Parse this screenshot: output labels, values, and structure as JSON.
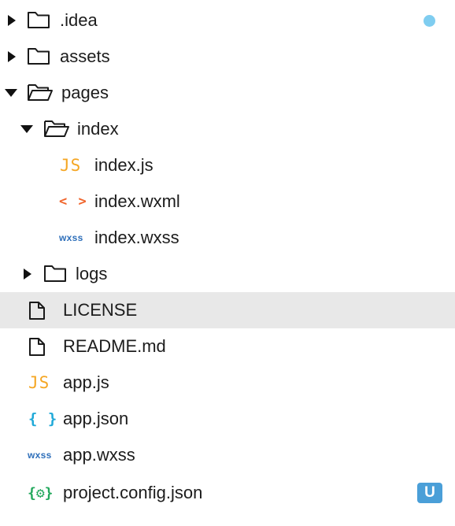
{
  "tree": {
    "items": [
      {
        "label": ".idea",
        "icon": "folder-icon",
        "state": "collapsed",
        "status": "modified-dot"
      },
      {
        "label": "assets",
        "icon": "folder-icon",
        "state": "collapsed"
      },
      {
        "label": "pages",
        "icon": "folder-open-icon",
        "state": "expanded"
      },
      {
        "label": "index",
        "icon": "folder-open-icon",
        "state": "expanded"
      },
      {
        "label": "index.js",
        "icon": "js-file-icon",
        "icon_text": "JS"
      },
      {
        "label": "index.wxml",
        "icon": "wxml-file-icon",
        "icon_text": "< >"
      },
      {
        "label": "index.wxss",
        "icon": "wxss-file-icon",
        "icon_text": "wxss"
      },
      {
        "label": "logs",
        "icon": "folder-icon",
        "state": "collapsed"
      },
      {
        "label": "LICENSE",
        "icon": "file-icon",
        "selected": true
      },
      {
        "label": "README.md",
        "icon": "file-icon"
      },
      {
        "label": "app.js",
        "icon": "js-file-icon",
        "icon_text": "JS"
      },
      {
        "label": "app.json",
        "icon": "json-file-icon",
        "icon_text": "{ }"
      },
      {
        "label": "app.wxss",
        "icon": "wxss-file-icon",
        "icon_text": "wxss"
      },
      {
        "label": "project.config.json",
        "icon": "config-file-icon",
        "icon_text": "{⚙}",
        "badge": "U"
      }
    ]
  },
  "colors": {
    "selected_row": "#e8e8e8",
    "js": "#f5a623",
    "wxml": "#f0642b",
    "wxss": "#2e6fba",
    "json": "#1fa9d8",
    "config": "#22a85c",
    "modified_dot": "#7fcdf0",
    "untracked_badge": "#4a9fd8"
  }
}
